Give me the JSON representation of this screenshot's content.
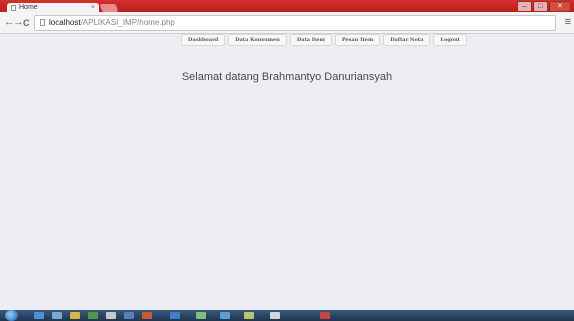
{
  "browser": {
    "tab_title": "Home",
    "tab_close": "×",
    "url_host": "localhost",
    "url_path": "/APLIKASI_IMP/home.php",
    "back": "←",
    "forward": "→",
    "reload": "C",
    "menu": "≡",
    "window_min": "–",
    "window_max": "□",
    "window_close": "✕"
  },
  "nav": {
    "items": [
      "Dashboard",
      "Data Konsumen",
      "Data Item",
      "Pesan Item",
      "Daftar Nota",
      "Logout"
    ]
  },
  "main": {
    "welcome_text": "Selamat datang Brahmantyo Danuriansyah"
  },
  "taskbar": {
    "accent_colors": [
      "#4d8fd6",
      "#7aa6d8",
      "#d8b54a",
      "#4a9a4a",
      "#c9c9c9",
      "#5a7fbf",
      "#c9593b",
      "#3f7fd0",
      "#7fbf7f",
      "#5a9fd6",
      "#b5c96a",
      "#d6d6d6",
      "#c94545"
    ]
  }
}
